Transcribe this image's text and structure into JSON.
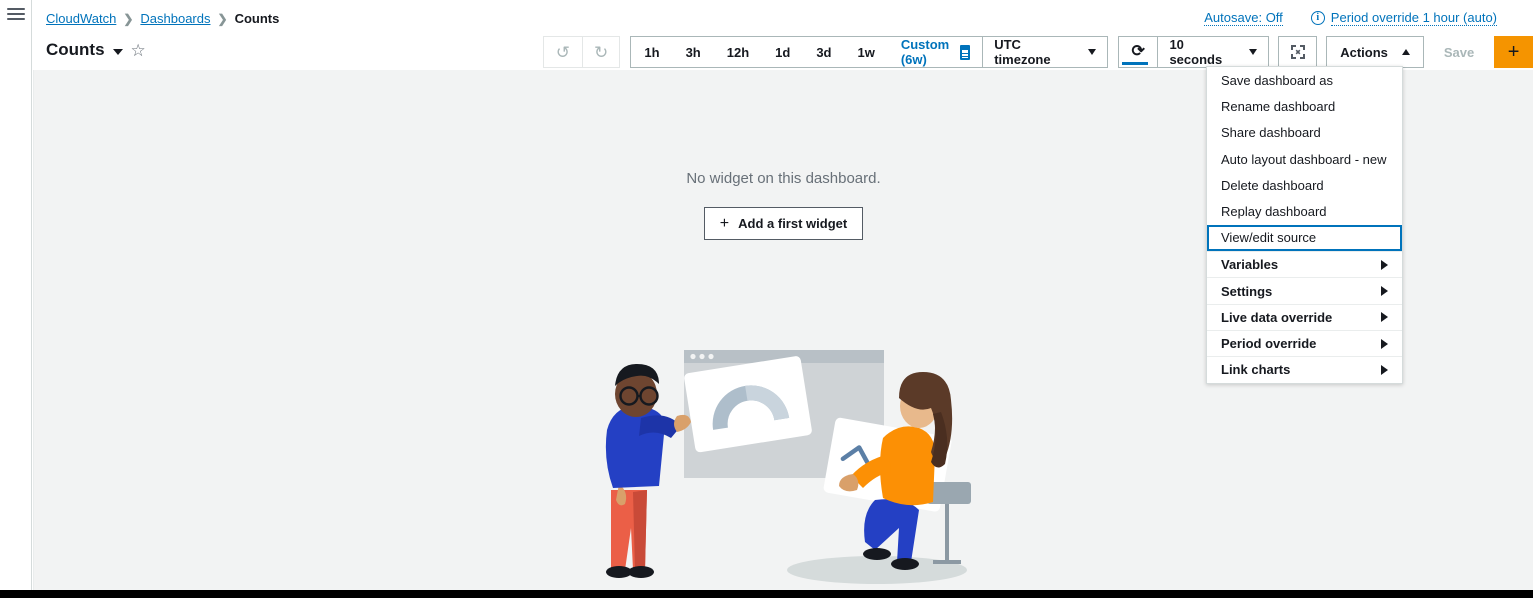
{
  "breadcrumb": {
    "items": [
      {
        "label": "CloudWatch",
        "link": true
      },
      {
        "label": "Dashboards",
        "link": true
      },
      {
        "label": "Counts",
        "link": false
      }
    ],
    "separator": "❯"
  },
  "header": {
    "autosave": "Autosave: Off",
    "period_override_note": "Period override 1 hour (auto)",
    "info_icon": "info-icon"
  },
  "title_row": {
    "title": "Counts",
    "caret_icon": "chevron-down-icon",
    "star_icon": "star-outline-icon",
    "star_glyph": "☆"
  },
  "toolbar": {
    "undo_icon": "undo-icon",
    "undo_glyph": "↺",
    "redo_icon": "redo-icon",
    "redo_glyph": "↺",
    "ranges": [
      "1h",
      "3h",
      "12h",
      "1d",
      "3d",
      "1w"
    ],
    "custom_range": "Custom (6w)",
    "calendar_icon": "calendar-icon",
    "timezone": "UTC timezone",
    "refresh_icon": "refresh-icon",
    "refresh_glyph": "⟳",
    "interval": "10 seconds",
    "fullscreen_icon": "fullscreen-icon",
    "actions": "Actions",
    "save": "Save",
    "add": "+"
  },
  "actions_menu": {
    "items": [
      {
        "label": "Save dashboard as",
        "submenu": false,
        "focused": false
      },
      {
        "label": "Rename dashboard",
        "submenu": false,
        "focused": false
      },
      {
        "label": "Share dashboard",
        "submenu": false,
        "focused": false
      },
      {
        "label": "Auto layout dashboard - new",
        "submenu": false,
        "focused": false
      },
      {
        "label": "Delete dashboard",
        "submenu": false,
        "focused": false
      },
      {
        "label": "Replay dashboard",
        "submenu": false,
        "focused": false
      },
      {
        "label": "View/edit source",
        "submenu": false,
        "focused": true
      },
      {
        "label": "Variables",
        "submenu": true,
        "focused": false
      },
      {
        "label": "Settings",
        "submenu": true,
        "focused": false
      },
      {
        "label": "Live data override",
        "submenu": true,
        "focused": false
      },
      {
        "label": "Period override",
        "submenu": true,
        "focused": false
      },
      {
        "label": "Link charts",
        "submenu": true,
        "focused": false
      }
    ]
  },
  "empty_state": {
    "message": "No widget on this dashboard.",
    "button_label": "Add a first widget",
    "button_plus": "+",
    "illustration": "two-people-arranging-dashboard-widgets-illustration"
  },
  "colors": {
    "accent_blue": "#0073bb",
    "orange_button": "#f59400",
    "text_dark": "#16191f",
    "text_muted": "#687078",
    "border": "#aab7b8",
    "content_bg": "#f2f3f3"
  }
}
